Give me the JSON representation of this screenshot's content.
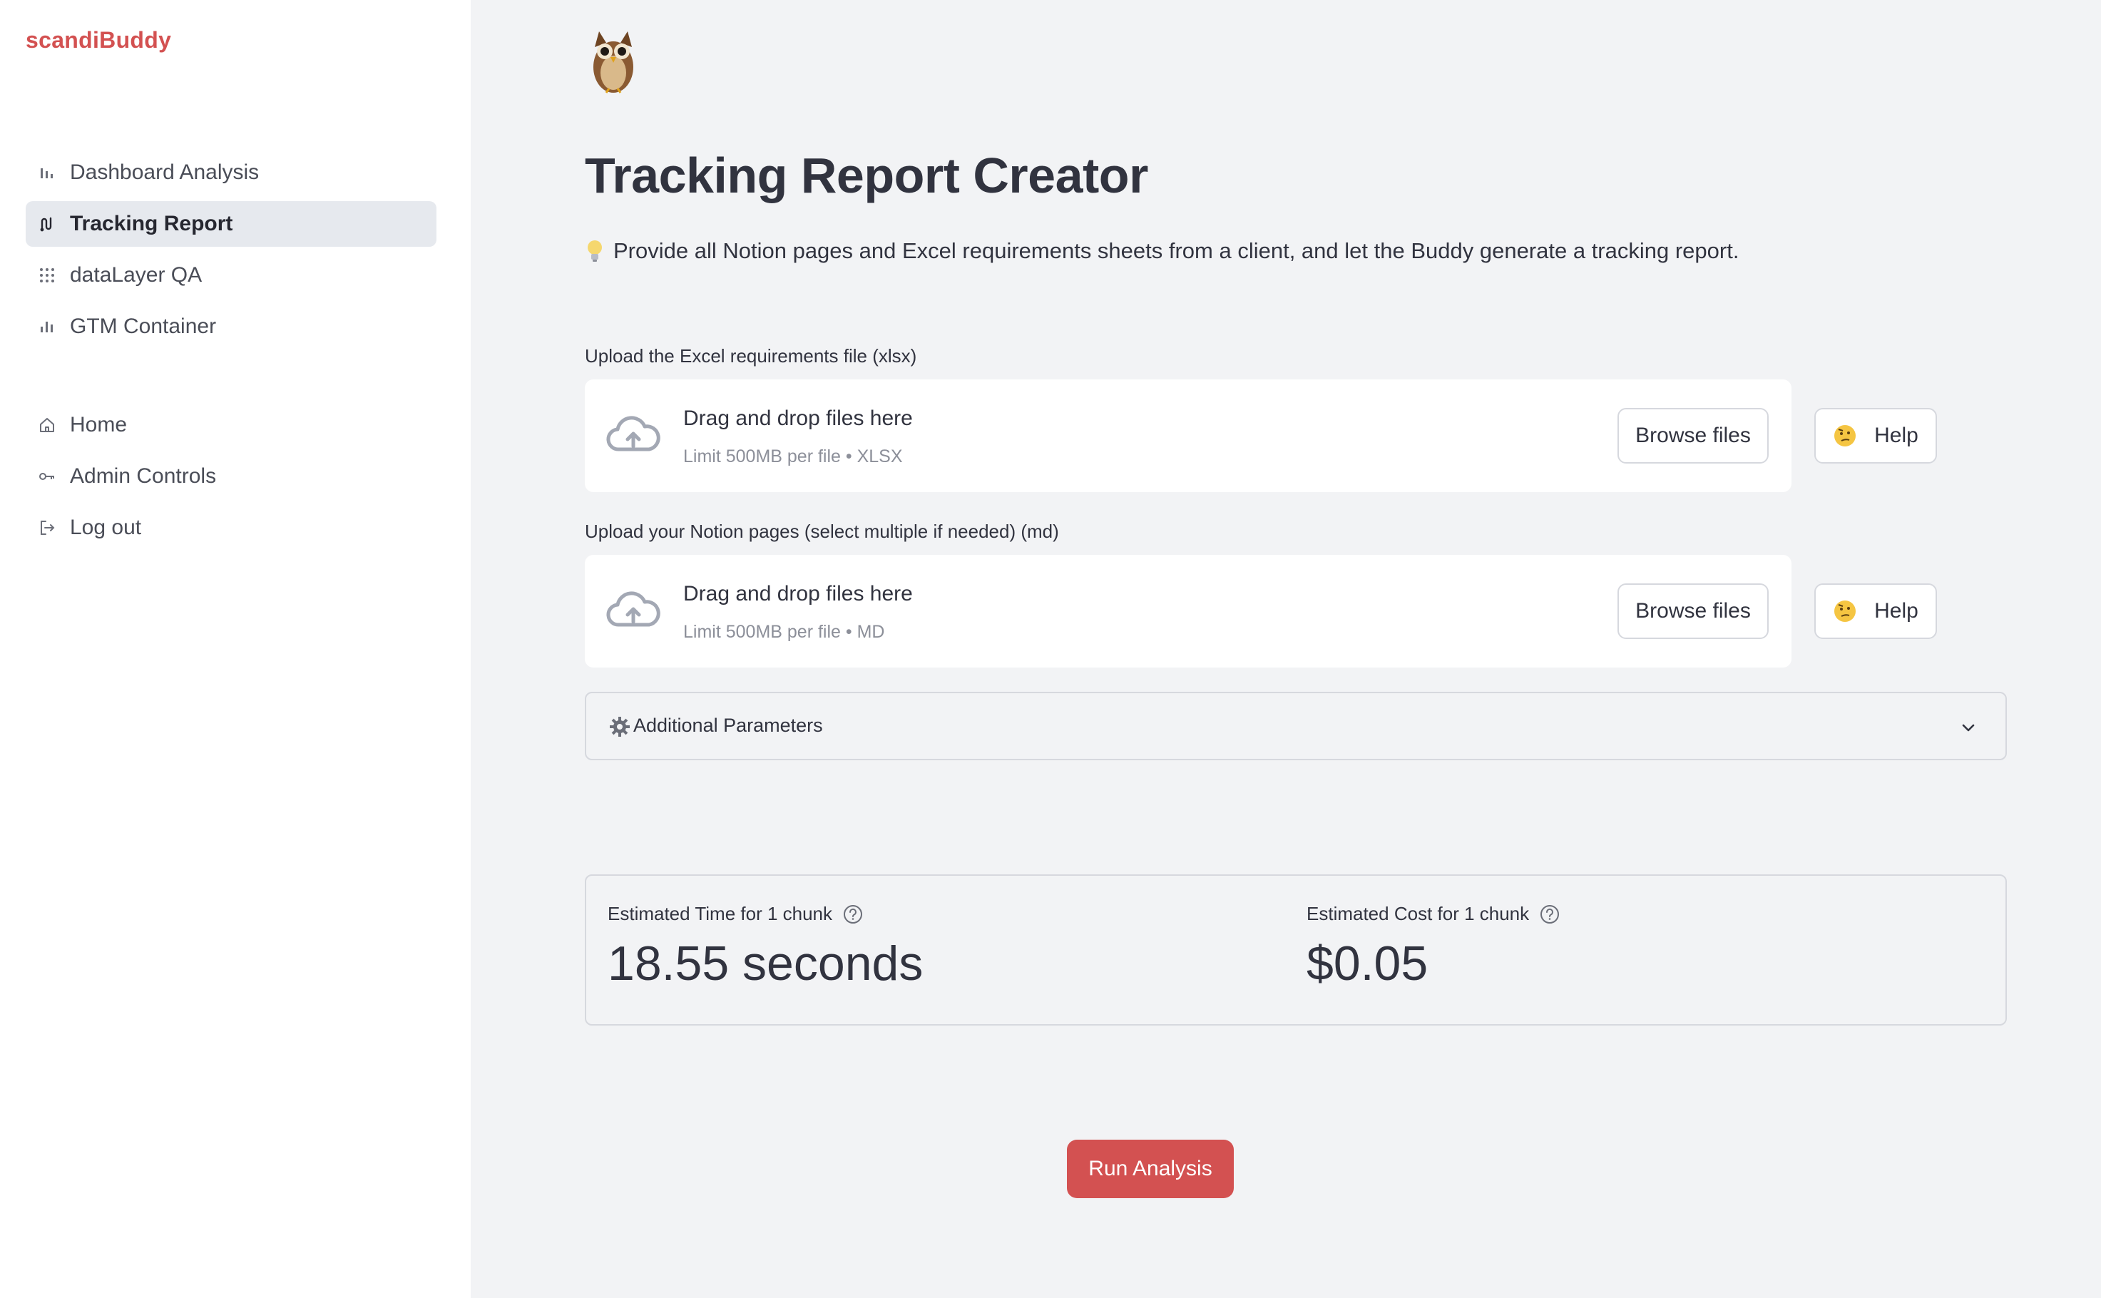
{
  "brand": "scandiBuddy",
  "sidebar": {
    "nav_top": [
      {
        "label": "Dashboard Analysis",
        "icon": "bar-chart-icon"
      },
      {
        "label": "Tracking Report",
        "icon": "route-icon",
        "active": true
      },
      {
        "label": "dataLayer QA",
        "icon": "grid-dots-icon"
      },
      {
        "label": "GTM Container",
        "icon": "bar-chart-icon"
      }
    ],
    "nav_bottom": [
      {
        "label": "Home",
        "icon": "home-icon"
      },
      {
        "label": "Admin Controls",
        "icon": "key-icon"
      },
      {
        "label": "Log out",
        "icon": "logout-icon"
      }
    ]
  },
  "main": {
    "header_icon": "owl-icon",
    "title": "Tracking Report Creator",
    "intro": "Provide all Notion pages and Excel requirements sheets from a client, and let the Buddy generate a tracking report.",
    "uploads": [
      {
        "label": "Upload the Excel requirements file (xlsx)",
        "dropzone_title": "Drag and drop files here",
        "dropzone_limit": "Limit 500MB per file • XLSX",
        "browse_label": "Browse files",
        "help_label": "Help"
      },
      {
        "label": "Upload your Notion pages (select multiple if needed) (md)",
        "dropzone_title": "Drag and drop files here",
        "dropzone_limit": "Limit 500MB per file • MD",
        "browse_label": "Browse files",
        "help_label": "Help"
      }
    ],
    "expander_label": "Additional Parameters",
    "metrics": [
      {
        "label": "Estimated Time for 1 chunk",
        "value": "18.55 seconds"
      },
      {
        "label": "Estimated Cost for 1 chunk",
        "value": "$0.05"
      }
    ],
    "run_button": "Run Analysis"
  },
  "colors": {
    "accent": "#d35151",
    "sidebar_bg": "#ffffff",
    "main_bg": "#f2f3f5",
    "active_nav_bg": "#e6e9ee"
  }
}
